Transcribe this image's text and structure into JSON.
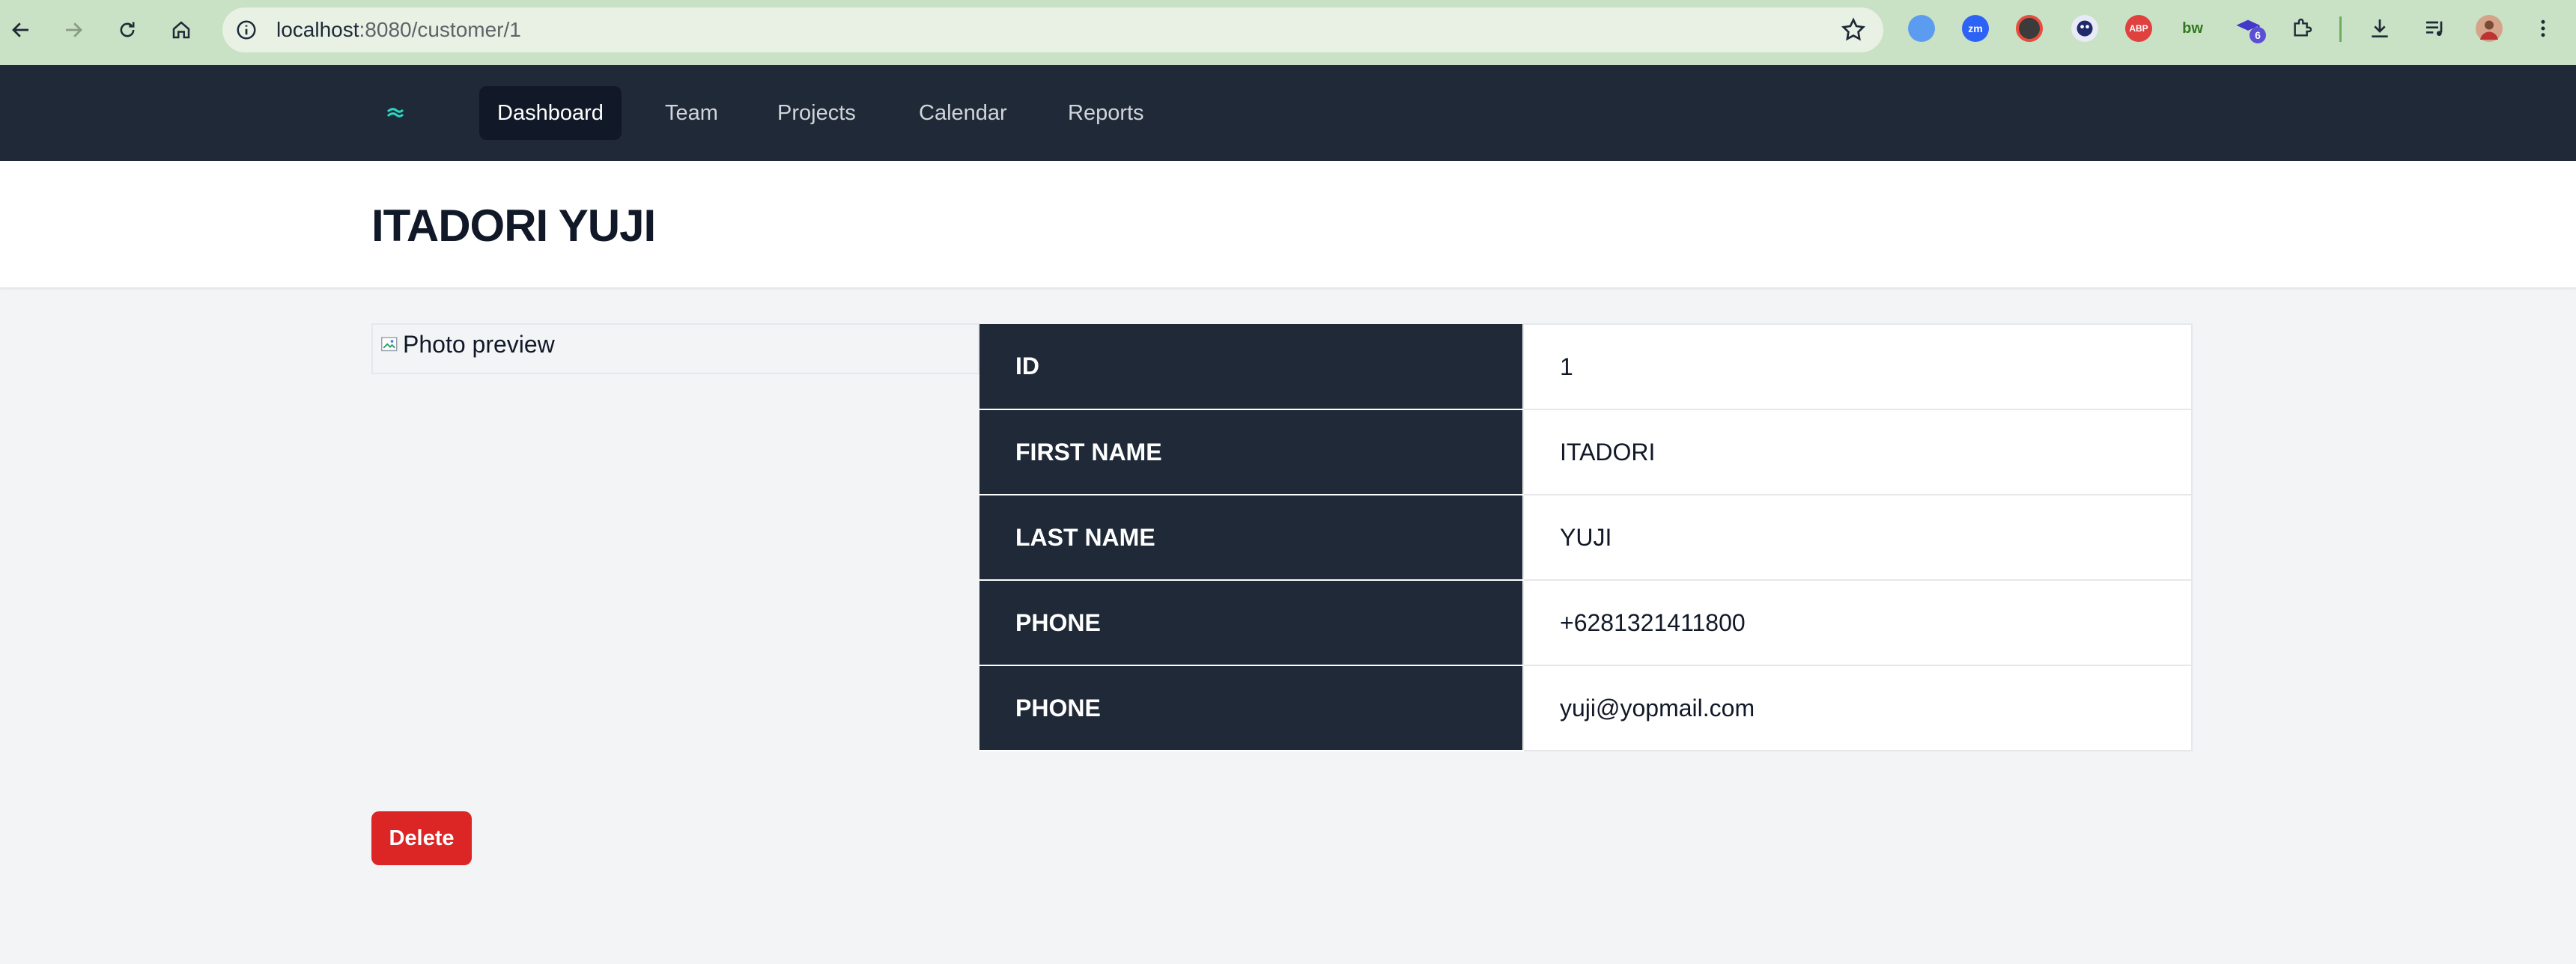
{
  "browser": {
    "url_host": "localhost",
    "url_path": ":8080/customer/1",
    "extensions": [
      {
        "name": "gemini-icon",
        "color": "#4a8fe7",
        "text": ""
      },
      {
        "name": "zoom-icon",
        "color": "#2d62f6",
        "text": "zm"
      },
      {
        "name": "chrome-icon",
        "color": "#3b3b3b",
        "text": ""
      },
      {
        "name": "mastodon-icon",
        "color": "#5b5fd6",
        "text": ""
      },
      {
        "name": "adblock-icon",
        "color": "#e0403e",
        "text": "ABP"
      },
      {
        "name": "bw-icon",
        "color": "#2f7a1e",
        "text": "bw"
      },
      {
        "name": "graduation-cap-icon",
        "color": "#4338ca",
        "text": ""
      }
    ],
    "badge_count": "6"
  },
  "nav": {
    "items": [
      {
        "label": "Dashboard",
        "active": true
      },
      {
        "label": "Team",
        "active": false
      },
      {
        "label": "Projects",
        "active": false
      },
      {
        "label": "Calendar",
        "active": false
      },
      {
        "label": "Reports",
        "active": false
      }
    ]
  },
  "header": {
    "title": "ITADORI YUJI"
  },
  "photo": {
    "alt": "Photo preview"
  },
  "details": {
    "rows": [
      {
        "key": "ID",
        "value": "1"
      },
      {
        "key": "FIRST NAME",
        "value": "ITADORI"
      },
      {
        "key": "LAST NAME",
        "value": "YUJI"
      },
      {
        "key": "PHONE",
        "value": "+6281321411800"
      },
      {
        "key": "PHONE",
        "value": "yuji@yopmail.com"
      }
    ]
  },
  "actions": {
    "delete_label": "Delete"
  },
  "colors": {
    "nav_bg": "#1f2937",
    "delete": "#dc2626",
    "chrome_bg": "#c9e1c4"
  }
}
